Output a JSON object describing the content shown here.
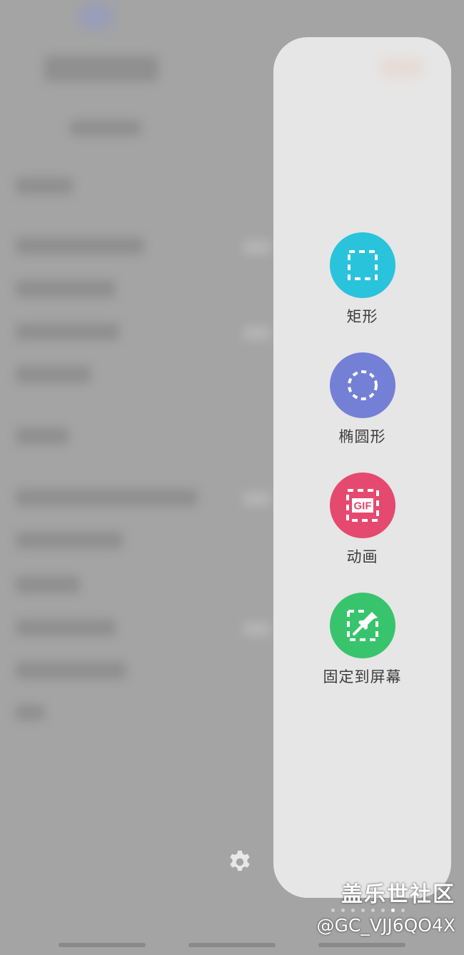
{
  "edge_panel": {
    "tools": [
      {
        "label": "矩形",
        "icon": "dashed-rectangle-icon",
        "color": "#29c3dc"
      },
      {
        "label": "椭圆形",
        "icon": "dashed-ellipse-icon",
        "color": "#7480d6"
      },
      {
        "label": "动画",
        "icon": "gif-icon",
        "icon_text": "GIF",
        "color": "#e5496f"
      },
      {
        "label": "固定到屏幕",
        "icon": "pin-to-screen-icon",
        "color": "#38c46c"
      }
    ],
    "settings_icon": "gear-icon"
  },
  "watermark": {
    "brand": "盖乐世社区",
    "user": "@GC_VJJ6QO4X"
  },
  "page_indicator": {
    "count": 8,
    "active_index": 6
  }
}
